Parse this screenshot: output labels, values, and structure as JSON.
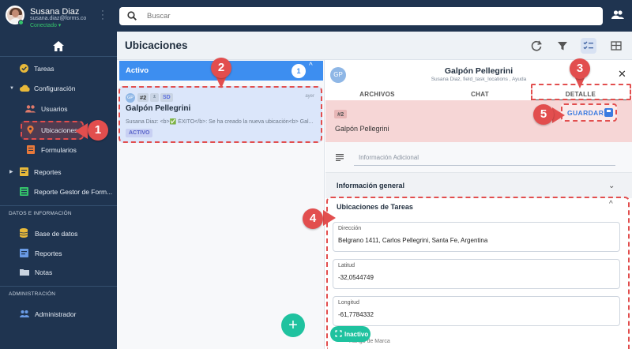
{
  "user": {
    "name": "Susana Diaz",
    "email": "susana.diaz@forms.co",
    "status": "Conectado ▾"
  },
  "search": {
    "placeholder": "Buscar"
  },
  "sidebar": {
    "items": [
      {
        "label": "Tareas"
      },
      {
        "label": "Configuración"
      },
      {
        "label": "Usuarios"
      },
      {
        "label": "Ubicaciones"
      },
      {
        "label": "Formularios"
      },
      {
        "label": "Reportes"
      },
      {
        "label": "Reporte Gestor de Form..."
      }
    ],
    "section_data": "DATOS E INFORMACIÓN",
    "data_items": [
      {
        "label": "Base de datos"
      },
      {
        "label": "Reportes"
      },
      {
        "label": "Notas"
      }
    ],
    "section_admin": "ADMINISTRACIÓN",
    "admin_items": [
      {
        "label": "Administrador"
      }
    ]
  },
  "page": {
    "title": "Ubicaciones"
  },
  "list": {
    "group_label": "Activo",
    "group_count": "1",
    "card": {
      "avatar": "GP",
      "id": "#2",
      "priority": "±",
      "initials": "SD",
      "time": "ayer",
      "title": "Galpón Pellegrini",
      "subtitle": "Susana Diaz: <b>✅ ÉXITO</b>: Se ha creado la nueva ubicación<b> Gal...",
      "badge": "ACTIVO"
    }
  },
  "detail": {
    "avatar": "GP",
    "title": "Galpón Pellegrini",
    "subtitle": "Susana Diaz, field_task_locations , Ayuda",
    "tabs": [
      {
        "label": "ARCHIVOS"
      },
      {
        "label": "CHAT"
      },
      {
        "label": "DETALLE"
      }
    ],
    "id": "#2",
    "name": "Galpón Pellegrini",
    "save_label": "GUARDAR",
    "info_placeholder": "Información Adicional",
    "general_label": "Información general",
    "tasks_label": "Ubicaciones de Tareas",
    "fields": [
      {
        "label": "Dirección",
        "value": "Belgrano 1411, Carlos Pellegrini, Santa Fe, Argentina"
      },
      {
        "label": "Latitud",
        "value": "-32,0544749"
      },
      {
        "label": "Longitud",
        "value": "-61,7784332"
      }
    ],
    "ghost_label": "Rango de Marca",
    "inactive_label": "Inactivo"
  },
  "callouts": [
    "1",
    "2",
    "3",
    "4",
    "5"
  ],
  "colors": {
    "sidebar": "#1f3450",
    "accent": "#3d8ef0",
    "highlight": "#e24e4e",
    "success": "#1fc29f"
  }
}
